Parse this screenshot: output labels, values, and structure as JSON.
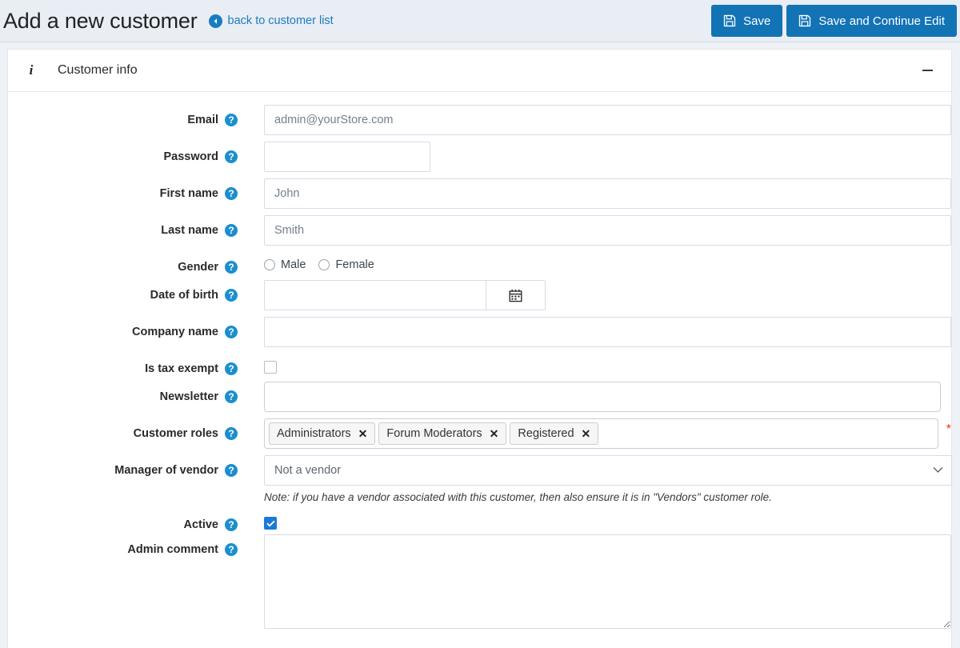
{
  "header": {
    "title": "Add a new customer",
    "back_link": "back to customer list",
    "back_icon": "arrow-circle-left-icon",
    "buttons": [
      {
        "label": "Save",
        "icon": "save-floppy-icon"
      },
      {
        "label": "Save and Continue Edit",
        "icon": "save-floppy-icon"
      }
    ],
    "accent_color": "#1273b5",
    "bar_background": "#e9edf4"
  },
  "panel": {
    "icon": "info-icon",
    "title": "Customer info",
    "collapse_icon": "minus-icon"
  },
  "form": {
    "help_icon": "question-circle-icon",
    "required_marker": "*",
    "fields": {
      "email": {
        "label": "Email",
        "placeholder": "admin@yourStore.com",
        "value": ""
      },
      "password": {
        "label": "Password",
        "placeholder": "",
        "value": ""
      },
      "first_name": {
        "label": "First name",
        "placeholder": "John",
        "value": ""
      },
      "last_name": {
        "label": "Last name",
        "placeholder": "Smith",
        "value": ""
      },
      "gender": {
        "label": "Gender",
        "options": [
          {
            "label": "Male",
            "selected": false
          },
          {
            "label": "Female",
            "selected": false
          }
        ]
      },
      "date_of_birth": {
        "label": "Date of birth",
        "value": "",
        "button_icon": "calendar-icon"
      },
      "company_name": {
        "label": "Company name",
        "value": ""
      },
      "is_tax_exempt": {
        "label": "Is tax exempt",
        "checked": false
      },
      "newsletter": {
        "label": "Newsletter",
        "value": ""
      },
      "customer_roles": {
        "label": "Customer roles",
        "required": true,
        "tags": [
          {
            "label": "Administrators",
            "remove_icon": "close-x-icon"
          },
          {
            "label": "Forum Moderators",
            "remove_icon": "close-x-icon"
          },
          {
            "label": "Registered",
            "remove_icon": "close-x-icon"
          }
        ]
      },
      "manager_of_vendor": {
        "label": "Manager of vendor",
        "selected": "Not a vendor",
        "options": [
          "Not a vendor"
        ],
        "note": "Note: if you have a vendor associated with this customer, then also ensure it is in \"Vendors\" customer role.",
        "arrow_icon": "chevron-down-icon"
      },
      "active": {
        "label": "Active",
        "checked": true
      },
      "admin_comment": {
        "label": "Admin comment",
        "value": ""
      }
    }
  }
}
